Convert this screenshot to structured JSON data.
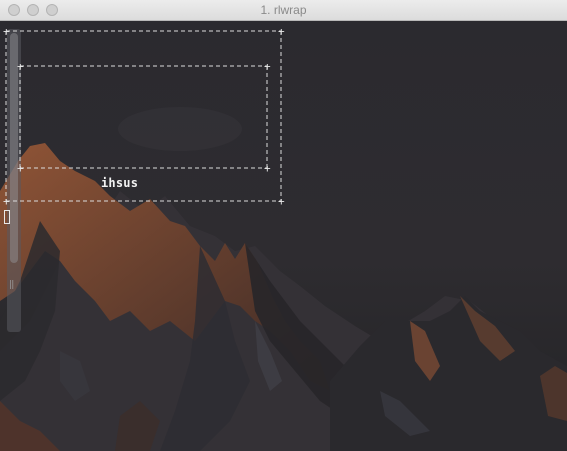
{
  "window": {
    "title": "1. rlwrap"
  },
  "terminal": {
    "box_label": "ihsus",
    "cursor_style": "block-outline"
  },
  "colors": {
    "terminal_text": "#e6e6e6",
    "titlebar": "#e5e5e5",
    "background": "#2b2b2f",
    "mountain_highlight": "#b8693f"
  },
  "icons": {
    "close": "traffic-light-close-icon",
    "minimize": "traffic-light-minimize-icon",
    "maximize": "traffic-light-maximize-icon"
  }
}
